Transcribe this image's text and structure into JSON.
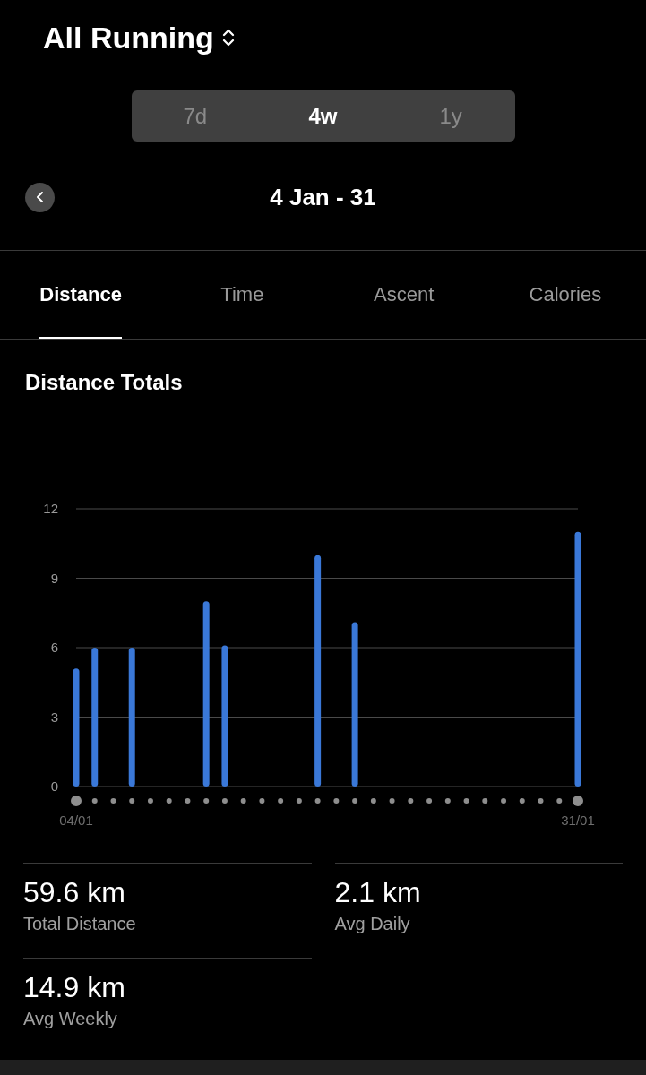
{
  "header": {
    "title": "All Running"
  },
  "ranges": [
    {
      "label": "7d",
      "selected": false
    },
    {
      "label": "4w",
      "selected": true
    },
    {
      "label": "1y",
      "selected": false
    }
  ],
  "period": {
    "label": "4 Jan - 31"
  },
  "tabs": [
    {
      "label": "Distance",
      "selected": true
    },
    {
      "label": "Time",
      "selected": false
    },
    {
      "label": "Ascent",
      "selected": false
    },
    {
      "label": "Calories",
      "selected": false
    }
  ],
  "section": {
    "title": "Distance Totals",
    "chart_data": {
      "type": "bar",
      "categories": [
        "04/01",
        null,
        null,
        null,
        null,
        null,
        null,
        null,
        null,
        null,
        null,
        null,
        null,
        null,
        null,
        null,
        null,
        null,
        null,
        null,
        null,
        null,
        null,
        null,
        null,
        null,
        null,
        "31/01"
      ],
      "series": [
        {
          "color": "#3a78d8",
          "values": [
            5.1,
            6,
            null,
            6,
            null,
            null,
            null,
            8,
            6.1,
            null,
            null,
            null,
            null,
            10,
            null,
            7.1,
            null,
            null,
            null,
            null,
            null,
            null,
            null,
            null,
            null,
            null,
            null,
            11
          ]
        }
      ],
      "ylim": [
        0,
        12
      ],
      "yticks": [
        0,
        3,
        6,
        9,
        12
      ],
      "grid": true
    }
  },
  "stats": [
    {
      "value": "59.6 km",
      "label": "Total Distance"
    },
    {
      "value": "2.1 km",
      "label": "Avg Daily"
    },
    {
      "value": "14.9 km",
      "label": "Avg Weekly"
    }
  ]
}
